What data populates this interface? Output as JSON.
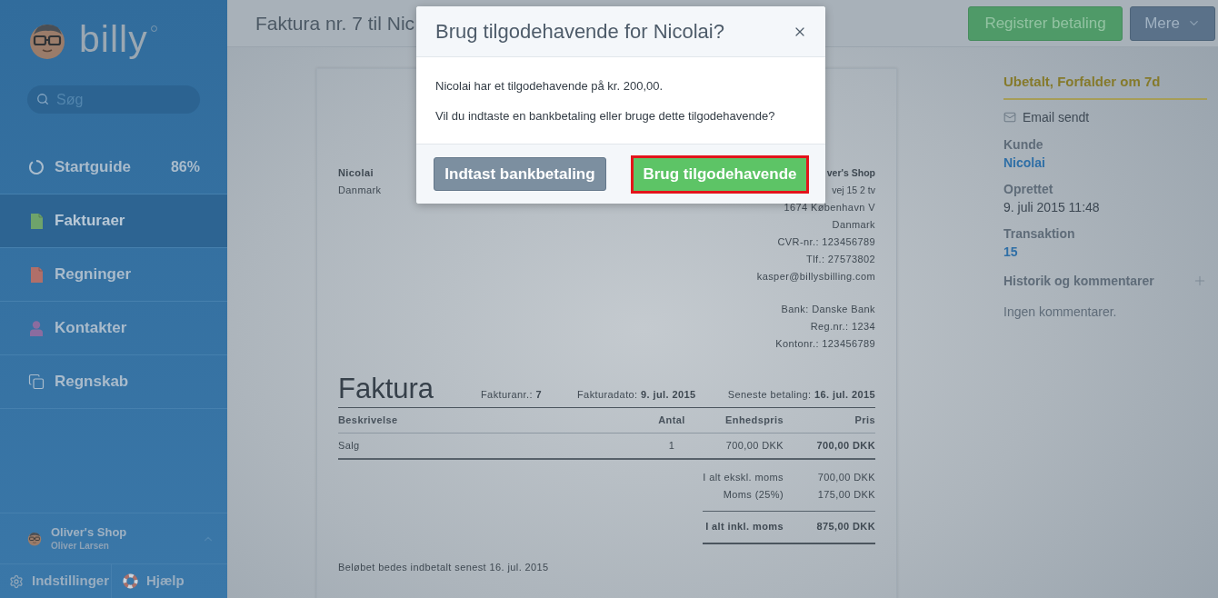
{
  "sidebar": {
    "logo": {
      "text": "billy"
    },
    "search": {
      "placeholder": "Søg"
    },
    "items": [
      {
        "label": "Startguide",
        "selected": false,
        "percent": "86%"
      },
      {
        "label": "Fakturaer",
        "selected": true
      },
      {
        "label": "Regninger",
        "selected": false
      },
      {
        "label": "Kontakter",
        "selected": false
      },
      {
        "label": "Regnskab",
        "selected": false
      }
    ],
    "account": {
      "company": "Oliver's Shop",
      "user": "Oliver Larsen"
    },
    "footer": [
      {
        "label": "Indstillinger"
      },
      {
        "label": "Hjælp"
      }
    ]
  },
  "topbar": {
    "title": "Faktura nr. 7 til Nic",
    "buttons": [
      {
        "label": "Registrer betaling",
        "kind": "primary"
      },
      {
        "label": "Mere",
        "kind": "dropdown"
      }
    ]
  },
  "invoice": {
    "recipient": {
      "name": "Nicolai",
      "lines": [
        "Danmark"
      ]
    },
    "sender": {
      "name": "ver's Shop",
      "lines": [
        "vej 15 2 tv",
        "1674 København V",
        "Danmark",
        "CVR-nr.: 123456789",
        "Tlf.: 27573802",
        "kasper@billysbilling.com"
      ]
    },
    "bank": [
      "Bank: Danske Bank",
      "Reg.nr.: 1234",
      "Kontonr.: 123456789"
    ],
    "heading": "Faktura",
    "meta": [
      "Fakturanr.: **7**",
      "Fakturadato: **9. jul. 2015**",
      "Seneste betaling: **16. jul. 2015**"
    ],
    "table": {
      "columns": [
        "Beskrivelse",
        "Antal",
        "Enhedspris",
        "Pris"
      ],
      "rows": [
        [
          "Salg",
          "1",
          "700,00 DKK",
          "700,00 DKK"
        ]
      ]
    },
    "totals": [
      {
        "label": "I alt ekskl. moms",
        "value": "700,00 DKK",
        "kind": "subtotal"
      },
      {
        "label": "Moms (25%)",
        "value": "175,00 DKK",
        "kind": "subtotal"
      },
      {
        "label": "I alt inkl. moms",
        "value": "875,00 DKK",
        "kind": "total"
      }
    ],
    "note": "Beløbet bedes indbetalt senest 16. jul. 2015"
  },
  "details": {
    "status": "Ubetalt, Forfalder om 7d",
    "email": "Email sendt",
    "fields": [
      {
        "label": "Kunde",
        "value": "Nicolai",
        "kind": "link"
      },
      {
        "label": "Oprettet",
        "value": "9. juli 2015 11:48",
        "kind": "text"
      },
      {
        "label": "Transaktion",
        "value": "15",
        "kind": "link"
      }
    ],
    "history": {
      "title": "Historik og kommentarer",
      "empty": "Ingen kommentarer."
    }
  },
  "dialog": {
    "title": "Brug tilgodehavende for Nicolai?",
    "paragraphs": [
      "Nicolai har et tilgodehavende på kr. 200,00.",
      "Vil du indtaste en bankbetaling eller bruge dette tilgodehavende?"
    ],
    "buttons": [
      {
        "label": "Indtast bankbetaling",
        "kind": "secondary",
        "highlighted": false
      },
      {
        "label": "Brug tilgodehavende",
        "kind": "primary",
        "highlighted": true
      }
    ]
  }
}
